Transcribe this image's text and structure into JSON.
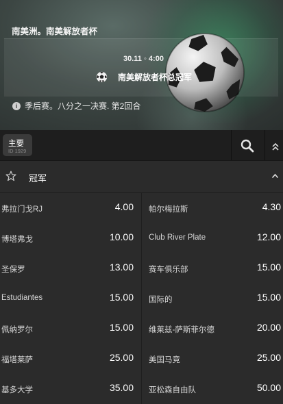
{
  "hero": {
    "league": "南美洲。南美解放者杯",
    "datetime": "30.11 ◦ 4:00",
    "match_title": "南美解放者杯总冠军",
    "info": "季后赛。八分之一决赛. 第2回合"
  },
  "tabs": {
    "main_label": "主要",
    "main_id": "ID 1929"
  },
  "market": {
    "name": "冠军"
  },
  "outcomes": [
    {
      "left": {
        "team": "弗拉门戈RJ",
        "odds": "4.00"
      },
      "right": {
        "team": "帕尔梅拉斯",
        "odds": "4.30"
      }
    },
    {
      "left": {
        "team": "博塔弗戈",
        "odds": "10.00"
      },
      "right": {
        "team": "Club River Plate",
        "odds": "12.00"
      }
    },
    {
      "left": {
        "team": "圣保罗",
        "odds": "13.00"
      },
      "right": {
        "team": "赛车俱乐部",
        "odds": "15.00"
      }
    },
    {
      "left": {
        "team": "Estudiantes",
        "odds": "15.00"
      },
      "right": {
        "team": "国际的",
        "odds": "15.00"
      }
    },
    {
      "left": {
        "team": "佩纳罗尔",
        "odds": "15.00"
      },
      "right": {
        "team": "维莱兹-萨斯菲尔德",
        "odds": "20.00"
      }
    },
    {
      "left": {
        "team": "福塔莱萨",
        "odds": "25.00"
      },
      "right": {
        "team": "美国马竞",
        "odds": "25.00"
      }
    },
    {
      "left": {
        "team": "基多大学",
        "odds": "35.00"
      },
      "right": {
        "team": "亚松森自由队",
        "odds": "50.00"
      }
    }
  ],
  "icons": {
    "info": "info-icon",
    "search": "search-icon",
    "collapse": "double-chevron-up-icon",
    "favorite": "star-icon",
    "section_toggle": "chevron-up-icon",
    "sport": "soccer-ball-icon"
  },
  "colors": {
    "background": "#2b2b2b",
    "tabbar": "#1e1e1e",
    "accent_green": "#3caa6e"
  }
}
